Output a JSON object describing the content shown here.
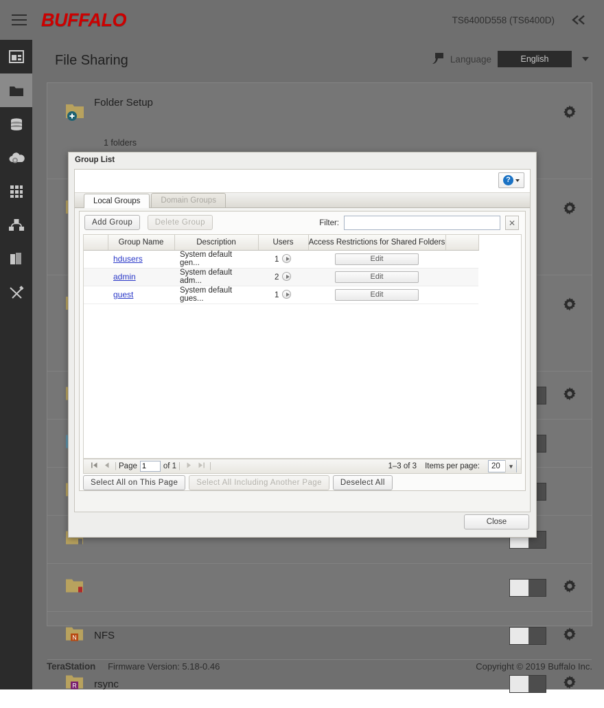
{
  "topbar": {
    "brand": "BUFFALO",
    "hostname": "TS6400D558 (TS6400D)",
    "menu_icon": "hamburger-icon",
    "collapse_icon": "chevron-double-left-icon"
  },
  "sidebar": {
    "items": [
      {
        "name": "dashboard",
        "icon": "dashboard-icon",
        "active": false
      },
      {
        "name": "file-sharing",
        "icon": "folder-icon",
        "active": true
      },
      {
        "name": "storage",
        "icon": "database-icon",
        "active": false
      },
      {
        "name": "cloud",
        "icon": "cloud-icon",
        "active": false
      },
      {
        "name": "applications",
        "icon": "grid-icon",
        "active": false
      },
      {
        "name": "network",
        "icon": "network-icon",
        "active": false
      },
      {
        "name": "backup",
        "icon": "books-icon",
        "active": false
      },
      {
        "name": "management",
        "icon": "tools-icon",
        "active": false
      }
    ]
  },
  "page": {
    "title": "File Sharing",
    "language_label": "Language",
    "language_value": "English",
    "language_icon": "language-icon"
  },
  "rows": [
    {
      "label": "Folder Setup",
      "sub": "1 folders",
      "icon": "folder-add-icon",
      "badge": "",
      "badge_color": "#1f6272",
      "gear": true,
      "toggle": null
    },
    {
      "label": "",
      "sub": "",
      "icon": "folder-icon",
      "badge": "",
      "badge_color": "#3f6fa8",
      "gear": true,
      "toggle": null
    },
    {
      "label": "",
      "sub": "",
      "icon": "folder-icon",
      "badge": "",
      "badge_color": "#2b5f8e",
      "gear": true,
      "toggle": null
    },
    {
      "label": "",
      "sub": "",
      "icon": "folder-icon",
      "badge": "",
      "badge_color": "#2b6fa8",
      "gear": false,
      "toggle": "off"
    },
    {
      "label": "",
      "sub": "",
      "icon": "folder-blue-icon",
      "badge": "",
      "badge_color": "#2b6fa8",
      "gear": false,
      "toggle": "off"
    },
    {
      "label": "",
      "sub": "",
      "icon": "folder-icon",
      "badge": "",
      "badge_color": "#2f7a44",
      "gear": false,
      "toggle": "off"
    },
    {
      "label": "",
      "sub": "",
      "icon": "folder-icon",
      "badge": "",
      "badge_color": "#6a6a6a",
      "gear": false,
      "toggle": "off"
    },
    {
      "label": "",
      "sub": "",
      "icon": "folder-icon",
      "badge": "",
      "badge_color": "#b02a2a",
      "gear": true,
      "toggle": "off"
    },
    {
      "label": "NFS",
      "sub": "",
      "icon": "folder-icon",
      "badge": "N",
      "badge_color": "#b84a12",
      "gear": true,
      "toggle": "off"
    },
    {
      "label": "rsync",
      "sub": "",
      "icon": "folder-icon",
      "badge": "R",
      "badge_color": "#7a1f6e",
      "gear": true,
      "toggle": "off"
    }
  ],
  "footer": {
    "product": "TeraStation",
    "firmware": "Firmware Version: 5.18-0.46",
    "copyright": "Copyright © 2019 Buffalo Inc."
  },
  "dialog": {
    "title": "Group List",
    "help_icon": "help-icon",
    "help_glyph": "?",
    "tabs": [
      {
        "label": "Local Groups",
        "active": true
      },
      {
        "label": "Domain Groups",
        "active": false
      }
    ],
    "toolbar": {
      "add_group": "Add Group",
      "delete_group": "Delete Group",
      "filter_label": "Filter:",
      "filter_value": "",
      "filter_placeholder": "",
      "clear_icon": "close-icon",
      "clear_glyph": "✕"
    },
    "table": {
      "columns": [
        "",
        "Group Name",
        "Description",
        "Users",
        "Access Restrictions for Shared Folders",
        ""
      ],
      "rows": [
        {
          "name": "hdusers",
          "description": "System default gen...",
          "users": "1",
          "action": "Edit"
        },
        {
          "name": "admin",
          "description": "System default adm...",
          "users": "2",
          "action": "Edit"
        },
        {
          "name": "guest",
          "description": "System default gues...",
          "users": "1",
          "action": "Edit"
        }
      ]
    },
    "pager": {
      "first_glyph": "⏮",
      "prev_glyph": "◀",
      "next_glyph": "▶",
      "last_glyph": "⏭",
      "page_label": "Page",
      "page_value": "1",
      "of_label": "of 1",
      "range": "1–3 of 3",
      "items_per_page_label": "Items per page:",
      "items_per_page_value": "20",
      "caret_glyph": "▾"
    },
    "select_buttons": {
      "select_page": "Select All on This Page",
      "select_all": "Select All Including Another Page",
      "deselect_all": "Deselect All"
    },
    "close": "Close"
  }
}
